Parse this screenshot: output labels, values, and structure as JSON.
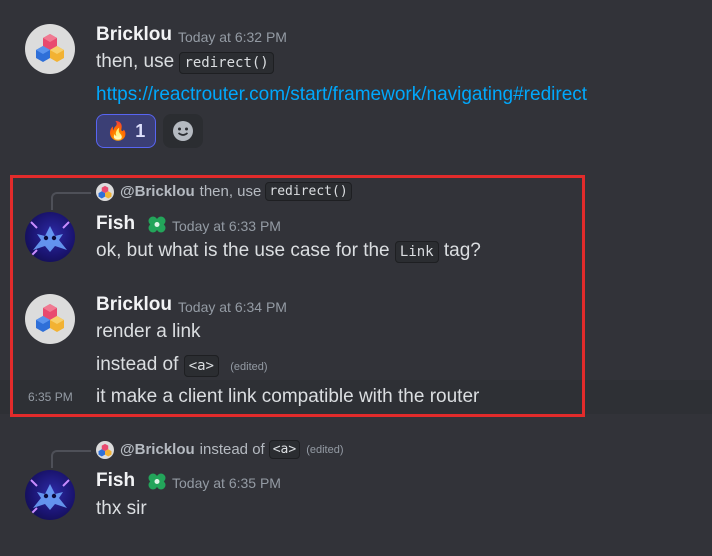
{
  "messages": [
    {
      "author": "Bricklou",
      "timestamp": "Today at 6:32 PM",
      "text_before_code": "then, use",
      "code": "redirect()",
      "link": "https://reactrouter.com/start/framework/navigating#redirect",
      "reaction": {
        "emoji": "🔥",
        "count": "1"
      }
    },
    {
      "reply": {
        "author": "@Bricklou",
        "text": "then, use",
        "code": "redirect()"
      },
      "author": "Fish",
      "timestamp": "Today at 6:33 PM",
      "text_before_code": "ok, but what is the use case for the",
      "code": "Link",
      "text_after_code": "tag?"
    },
    {
      "author": "Bricklou",
      "timestamp": "Today at 6:34 PM",
      "line1": "render a link",
      "line2_before_code": "instead of",
      "line2_code": "<a>",
      "edited": "(edited)",
      "line3_time": "6:35 PM",
      "line3": "it make a client link compatible with the router"
    },
    {
      "reply": {
        "author": "@Bricklou",
        "text": "instead of",
        "code": "<a>",
        "edited": "(edited)"
      },
      "author": "Fish",
      "timestamp": "Today at 6:35 PM",
      "text": "thx sir"
    }
  ],
  "colors": {
    "background": "#323339",
    "link": "#00a8fc",
    "highlight_border": "#e22b2b",
    "badge_green": "#23a55a"
  },
  "icons": {
    "bricklou_avatar": "colorful-cube-logo",
    "fish_avatar": "blue-fish-creature",
    "badge": "clover-badge-icon",
    "add_reaction": "smiley-face-icon"
  }
}
